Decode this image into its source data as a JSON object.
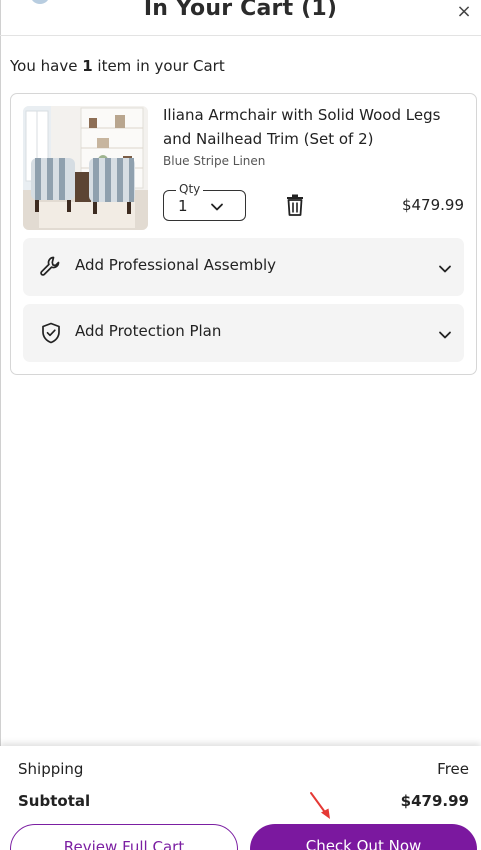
{
  "header": {
    "title": "In Your Cart (1)",
    "close_glyph": "×"
  },
  "summary": {
    "prefix": "You have ",
    "count": "1",
    "suffix": " item in your Cart"
  },
  "item": {
    "name": "Iliana Armchair with Solid Wood Legs and Nailhead Trim (Set of 2)",
    "variant": "Blue Stripe Linen",
    "qty_label": "Qty",
    "qty_value": "1",
    "price": "$479.99",
    "image_icon": "armchair-photo"
  },
  "addons": [
    {
      "label": "Add Professional Assembly",
      "icon": "wrench-icon"
    },
    {
      "label": "Add Protection Plan",
      "icon": "shield-check-icon"
    }
  ],
  "totals": {
    "shipping_label": "Shipping",
    "shipping_value": "Free",
    "subtotal_label": "Subtotal",
    "subtotal_value": "$479.99"
  },
  "buttons": {
    "review": "Review Full Cart",
    "checkout": "Check Out Now"
  },
  "colors": {
    "brand_purple": "#7b189f",
    "annotation_red": "#e53935"
  }
}
